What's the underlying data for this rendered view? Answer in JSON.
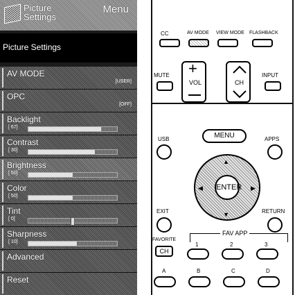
{
  "menu": {
    "header_title": "Picture Settings",
    "header_menu": "Menu",
    "section_title": "Picture Settings",
    "items": [
      {
        "label": "AV MODE",
        "value": "[USER]"
      },
      {
        "label": "OPC",
        "value": "[OFF]"
      },
      {
        "label": "Backlight",
        "num": "[ 67]",
        "level": 0.82
      },
      {
        "label": "Contrast",
        "num": "[ 30]",
        "level": 0.75
      },
      {
        "label": "Brightness",
        "num": "[ 50]",
        "level": 0.5
      },
      {
        "label": "Color",
        "num": "[ 50]",
        "level": 0.5
      },
      {
        "label": "Tint",
        "num": "[ 0]",
        "level": 0.5
      },
      {
        "label": "Sharpness",
        "num": "[ 10]",
        "level": 0.55
      },
      {
        "label": "Advanced"
      },
      {
        "label": "Reset"
      }
    ]
  },
  "remote": {
    "top_labels": [
      "CC",
      "AV MODE",
      "VIEW MODE",
      "FLASHBACK"
    ],
    "mute": "MUTE",
    "vol": "VOL",
    "ch": "CH",
    "input": "INPUT",
    "usb": "USB",
    "menu": "MENU",
    "apps": "APPS",
    "enter": "ENTER",
    "exit": "EXIT",
    "return": "RETURN",
    "favorite": "FAVORITE",
    "favorite_ch": "CH",
    "fav_app": "FAV APP",
    "fav_numbers": [
      "1",
      "2",
      "3"
    ],
    "letters": [
      "A",
      "B",
      "C",
      "D"
    ]
  }
}
